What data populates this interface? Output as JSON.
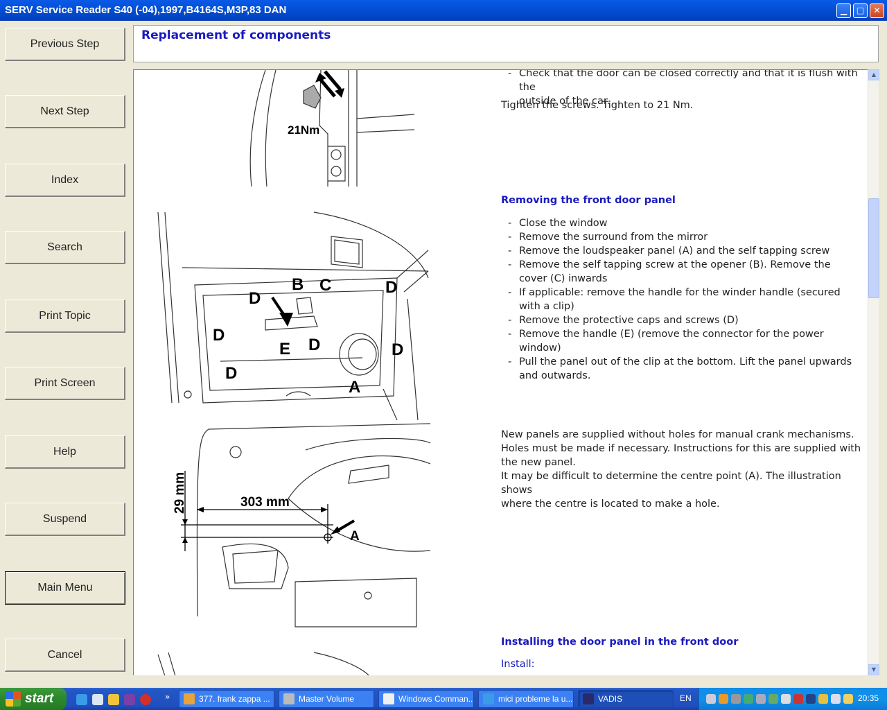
{
  "window": {
    "title": "SERV Service Reader S40 (-04),1997,B4164S,M3P,83 DAN",
    "controls": [
      "minimize",
      "maximize",
      "close"
    ]
  },
  "nav": {
    "previous_step": "Previous Step",
    "next_step": "Next Step",
    "index": "Index",
    "search": "Search",
    "print_topic": "Print Topic",
    "print_screen": "Print Screen",
    "help": "Help",
    "suspend": "Suspend",
    "main_menu": "Main Menu",
    "cancel": "Cancel"
  },
  "header": {
    "title": "Replacement of components"
  },
  "content": {
    "top_bullet_1": "Check that the door can be closed correctly and that it is flush with the",
    "top_bullet_1_cont": "outside of the car.",
    "tighten": "Tighten the screws. Tighten to 21 Nm.",
    "section1": {
      "heading": "Removing the front door panel",
      "steps": [
        "Close the window",
        "Remove the surround from the mirror",
        "Remove the loudspeaker panel (A) and the self tapping screw",
        "Remove the self tapping screw at the opener (B). Remove the cover (C) inwards",
        "If applicable: remove the handle for the winder handle (secured with a clip)",
        "Remove the protective caps and screws (D)",
        "Remove the handle (E) (remove the connector for the power window)",
        "Pull the panel out of the clip at the bottom. Lift the panel upwards and outwards."
      ]
    },
    "note_lines": [
      "New panels are supplied without holes for manual crank mechanisms.",
      "Holes must be made if necessary. Instructions for this are supplied with",
      "the new panel.",
      "It may be difficult to determine the centre point (A). The illustration shows",
      "where the centre is located to make a hole."
    ],
    "section2": {
      "heading": "Installing the door panel in the front door",
      "sub": "Install:"
    },
    "figure_labels": {
      "torque": "21Nm",
      "b": "B",
      "c": "C",
      "d": "D",
      "e": "E",
      "a": "A",
      "dim_h": "303 mm",
      "dim_v": "29 mm"
    }
  },
  "taskbar": {
    "start": "start",
    "tasks": [
      "377. frank zappa ...",
      "Master Volume",
      "Windows Comman...",
      "mici probleme la u...",
      "VADIS"
    ],
    "language": "EN",
    "clock": "20:35"
  }
}
